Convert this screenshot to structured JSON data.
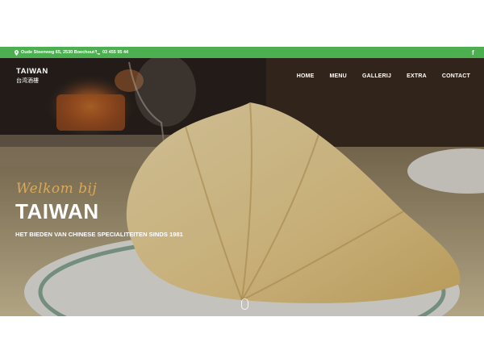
{
  "topbar": {
    "address": "Oude Steenweg 65, 2530 Boechout",
    "phone": "03 455 95 44",
    "social": "f"
  },
  "logo": {
    "name": "TAIWAN",
    "chinese": "台湾酒樓"
  },
  "nav": {
    "items": [
      "HOME",
      "MENU",
      "GALLERIJ",
      "EXTRA",
      "CONTACT"
    ]
  },
  "hero": {
    "welcome": "Welkom bij",
    "title": "TAIWAN",
    "subtitle": "HET BIEDEN VAN CHINESE SPECIALITEITEN SINDS 1981"
  },
  "colors": {
    "topbar": "#4caf50",
    "accent": "#d9a95a"
  },
  "icons": [
    "map-pin-icon",
    "phone-icon",
    "facebook-icon",
    "scroll-mouse-icon"
  ]
}
